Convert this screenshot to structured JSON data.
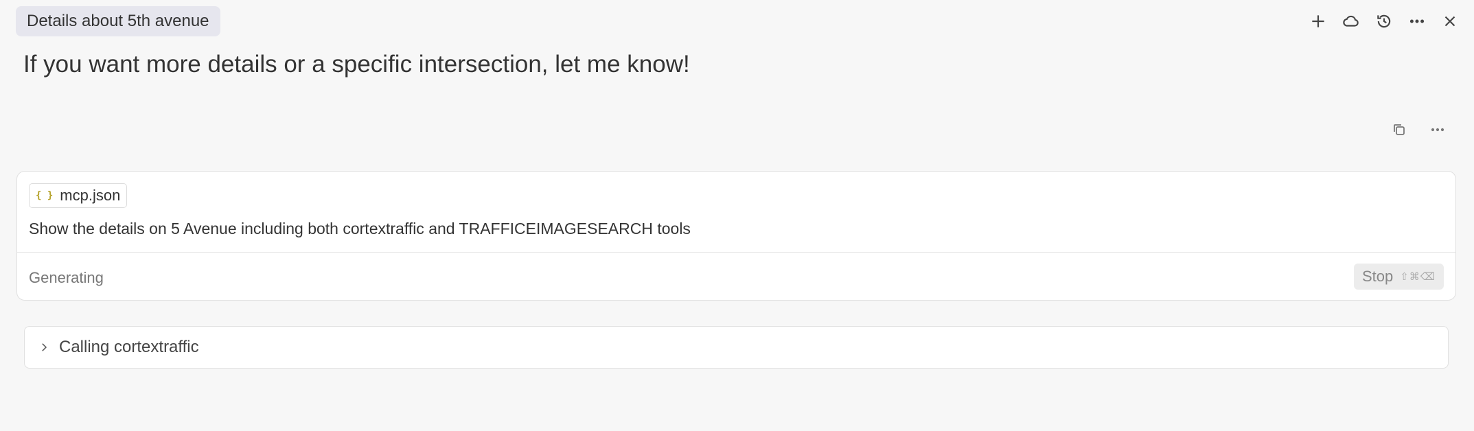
{
  "header": {
    "chat_title": "Details about 5th avenue",
    "actions": [
      {
        "icon": "plus-icon"
      },
      {
        "icon": "cloud-icon"
      },
      {
        "icon": "history-icon"
      },
      {
        "icon": "more-icon"
      },
      {
        "icon": "close-icon"
      }
    ]
  },
  "message": {
    "text": "If you want more details or a specific intersection, let me know!",
    "actions": [
      {
        "icon": "copy-icon"
      },
      {
        "icon": "more-icon"
      }
    ]
  },
  "composer": {
    "context_chip": {
      "icon": "json-file-icon",
      "icon_glyph": "{ }",
      "label": "mcp.json"
    },
    "prompt": "Show the details on 5 Avenue including both cortextraffic and TRAFFICEIMAGESEARCH tools",
    "status": "Generating",
    "stop_label": "Stop",
    "stop_shortcut": "⇧⌘⌫"
  },
  "tool_call": {
    "icon": "chevron-right-icon",
    "label": "Calling cortextraffic"
  }
}
